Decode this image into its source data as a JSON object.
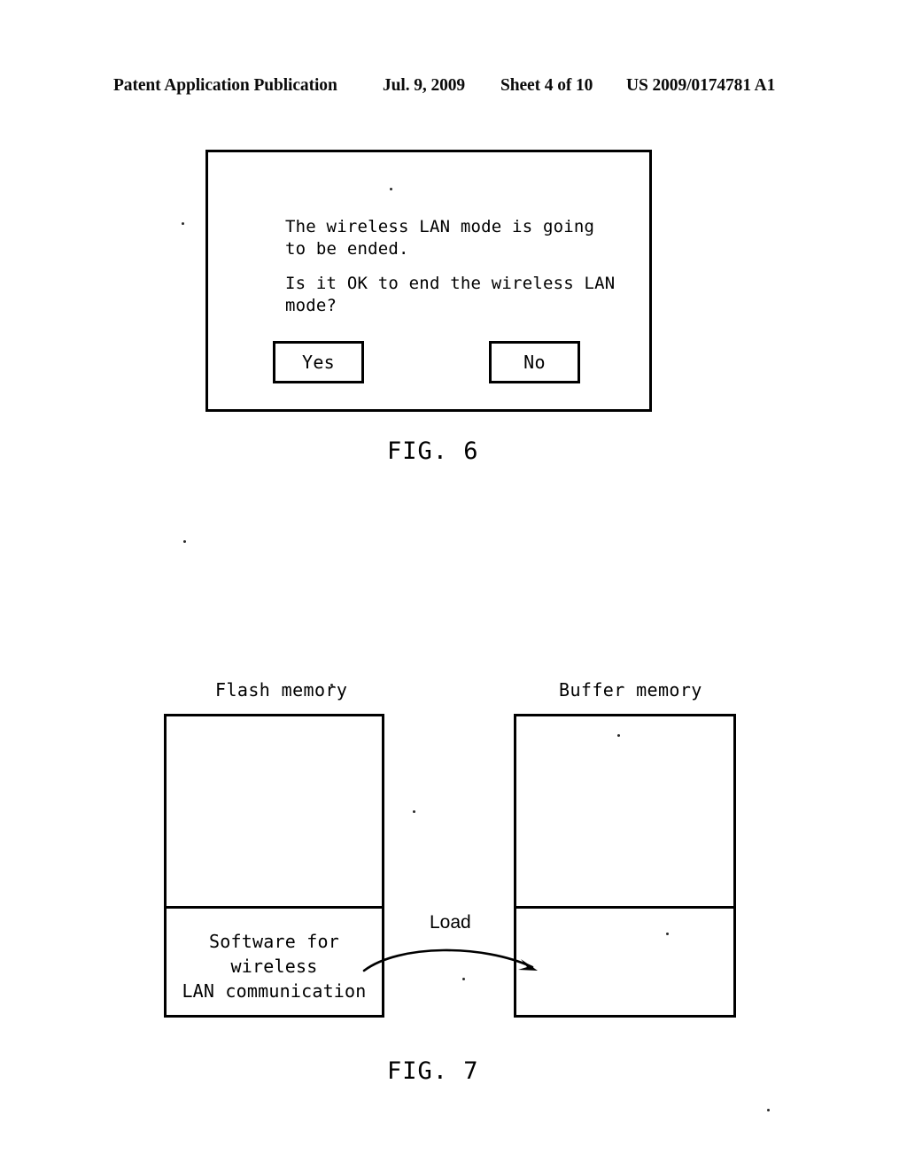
{
  "header": {
    "publication": "Patent Application Publication",
    "date": "Jul. 9, 2009",
    "sheet": "Sheet 4 of 10",
    "patent_number": "US 2009/0174781 A1"
  },
  "figure6": {
    "caption": "FIG. 6",
    "dialog": {
      "message_line1": "The wireless LAN mode is going\nto be ended.",
      "message_line2": "Is it OK to end the wireless LAN\nmode?",
      "yes_label": "Yes",
      "no_label": "No"
    }
  },
  "figure7": {
    "caption": "FIG. 7",
    "flash_memory": {
      "title": "Flash memory",
      "segment_label": "Software for wireless\nLAN communication"
    },
    "buffer_memory": {
      "title": "Buffer memory",
      "segment_label": ""
    },
    "arrow_label": "Load"
  },
  "colors": {
    "ink": "#000000",
    "paper": "#ffffff"
  }
}
